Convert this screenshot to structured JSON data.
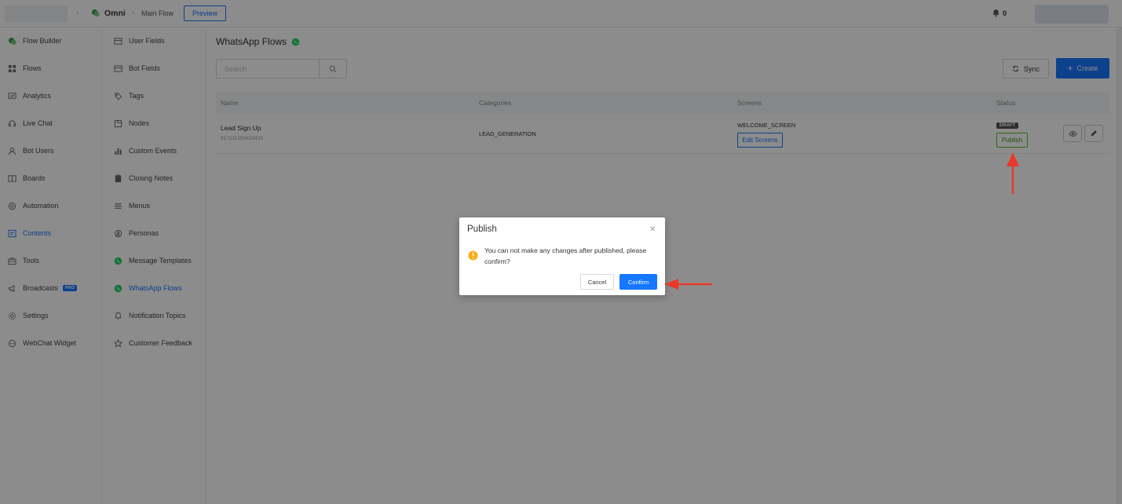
{
  "header": {
    "breadcrumb_omni": "Omni",
    "breadcrumb_main_flow": "Main Flow",
    "preview_label": "Preview",
    "notification_count": "0"
  },
  "primary_nav": [
    {
      "label": "Flow Builder",
      "icon": "flow-builder-icon"
    },
    {
      "label": "Flows",
      "icon": "grid-icon"
    },
    {
      "label": "Analytics",
      "icon": "chart-icon"
    },
    {
      "label": "Live Chat",
      "icon": "headset-icon"
    },
    {
      "label": "Bot Users",
      "icon": "user-icon"
    },
    {
      "label": "Boards",
      "icon": "board-icon"
    },
    {
      "label": "Automation",
      "icon": "gear-loop-icon"
    },
    {
      "label": "Contents",
      "icon": "contents-icon",
      "active": true
    },
    {
      "label": "Tools",
      "icon": "toolbox-icon"
    },
    {
      "label": "Broadcasts",
      "icon": "megaphone-icon",
      "badge": "PRO"
    },
    {
      "label": "Settings",
      "icon": "gear-icon"
    },
    {
      "label": "WebChat Widget",
      "icon": "chat-widget-icon"
    }
  ],
  "secondary_nav": [
    {
      "label": "User Fields",
      "icon": "table-icon"
    },
    {
      "label": "Bot Fields",
      "icon": "table-icon"
    },
    {
      "label": "Tags",
      "icon": "tag-icon"
    },
    {
      "label": "Nodes",
      "icon": "node-icon"
    },
    {
      "label": "Custom Events",
      "icon": "bar-chart-icon"
    },
    {
      "label": "Closing Notes",
      "icon": "note-icon"
    },
    {
      "label": "Menus",
      "icon": "menu-icon"
    },
    {
      "label": "Personas",
      "icon": "persona-icon"
    },
    {
      "label": "Message Templates",
      "icon": "whatsapp-icon"
    },
    {
      "label": "WhatsApp Flows",
      "icon": "whatsapp-icon",
      "active": true
    },
    {
      "label": "Notification Topics",
      "icon": "bell-icon"
    },
    {
      "label": "Customer Feedback",
      "icon": "star-icon"
    }
  ],
  "main": {
    "title": "WhatsApp Flows",
    "search_placeholder": "Search",
    "sync_label": "Sync",
    "create_label": "Create",
    "table_headers": {
      "name": "Name",
      "categories": "Categories",
      "screens": "Screens",
      "status": "Status"
    },
    "rows": [
      {
        "name": "Lead Sign Up",
        "id": "817211350433433",
        "category": "LEAD_GENERATION",
        "screen": "WELCOME_SCREEN",
        "edit_screens_label": "Edit Screens",
        "status_badge": "DRAFT",
        "publish_label": "Publish"
      }
    ]
  },
  "modal": {
    "title": "Publish",
    "message": "You can not make any changes after published, please confirm?",
    "cancel_label": "Cancel",
    "confirm_label": "Confirm"
  },
  "colors": {
    "accent": "#1677ff",
    "whatsapp_green": "#25d366",
    "publish_green": "#52c41a",
    "warning_orange": "#faad14",
    "annotation_red": "#e8392a"
  }
}
